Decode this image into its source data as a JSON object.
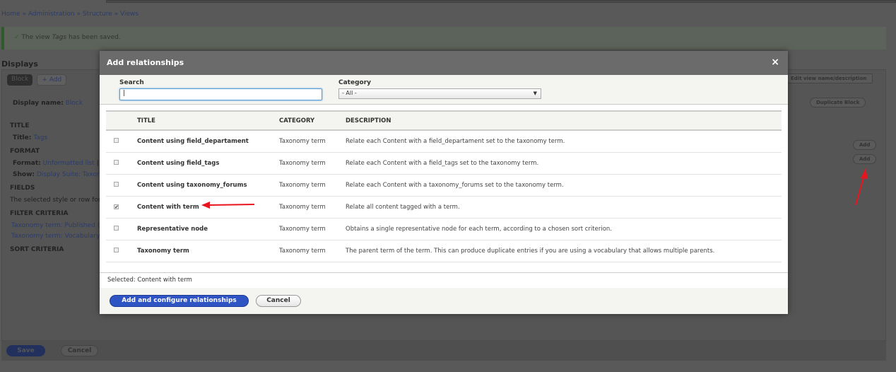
{
  "background": {
    "breadcrumb": [
      "Home",
      "Administration",
      "Structure",
      "Views"
    ],
    "status_prefix": "The view ",
    "status_view": "Tags",
    "status_suffix": " has been saved.",
    "displays_heading": "Displays",
    "display_tab": "Block",
    "add_display": "+ Add",
    "display_name_label": "Display name:",
    "display_name_value": "Block",
    "title_heading": "TITLE",
    "title_label": "Title:",
    "title_value": "Tags",
    "format_heading": "FORMAT",
    "format_label": "Format:",
    "format_value": "Unformatted list",
    "show_label": "Show:",
    "show_value": "Display Suite: Taxonom",
    "fields_heading": "FIELDS",
    "fields_text": "The selected style or row forma",
    "filter_heading": "FILTER CRITERIA",
    "filters": [
      "Taxonomy term: Published (= T",
      "Taxonomy term: Vocabulary (="
    ],
    "sort_heading": "SORT CRITERIA",
    "edit_view_button": "Edit view name/description",
    "duplicate_button": "Duplicate Block",
    "add_buttons": [
      "Add",
      "Add"
    ],
    "save_button": "Save",
    "cancel_button": "Cancel"
  },
  "modal": {
    "title": "Add relationships",
    "close": "×",
    "search_label": "Search",
    "search_value": "",
    "category_label": "Category",
    "category_value": "- All -",
    "columns": [
      "TITLE",
      "CATEGORY",
      "DESCRIPTION"
    ],
    "rows": [
      {
        "title": "Content using field_departament",
        "category": "Taxonomy term",
        "description": "Relate each Content with a field_departament set to the taxonomy term.",
        "checked": false
      },
      {
        "title": "Content using field_tags",
        "category": "Taxonomy term",
        "description": "Relate each Content with a field_tags set to the taxonomy term.",
        "checked": false
      },
      {
        "title": "Content using taxonomy_forums",
        "category": "Taxonomy term",
        "description": "Relate each Content with a taxonomy_forums set to the taxonomy term.",
        "checked": false
      },
      {
        "title": "Content with term",
        "category": "Taxonomy term",
        "description": "Relate all content tagged with a term.",
        "checked": true
      },
      {
        "title": "Representative node",
        "category": "Taxonomy term",
        "description": "Obtains a single representative node for each term, according to a chosen sort criterion.",
        "checked": false
      },
      {
        "title": "Taxonomy term",
        "category": "Taxonomy term",
        "description": "The parent term of the term. This can produce duplicate entries if you are using a vocabulary that allows multiple parents.",
        "checked": false
      }
    ],
    "selected_text": "Selected: Content with term",
    "submit_button": "Add and configure relationships",
    "cancel_button": "Cancel"
  },
  "colors": {
    "primary": "#2f54c4",
    "annotation_arrow": "#e8141e",
    "overlay": "#595959"
  }
}
